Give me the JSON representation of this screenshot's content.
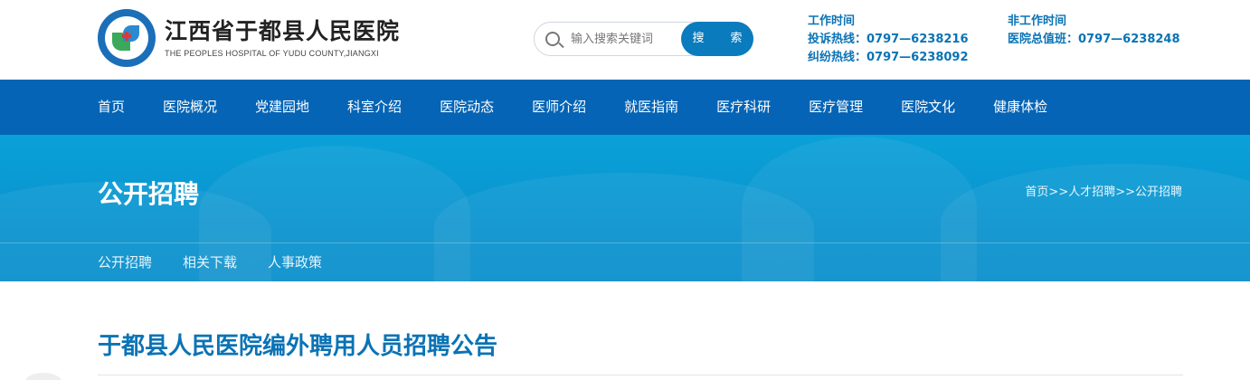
{
  "header": {
    "logo_cn": "江西省于都县人民医院",
    "logo_en": "THE PEOPLES HOSPITAL OF YUDU COUNTY,JIANGXI",
    "search_placeholder": "输入搜索关键词",
    "search_button": "搜　索",
    "contact_left": {
      "label": "工作时间",
      "line1": "投诉热线：0797—6238216",
      "line2": "纠纷热线：0797—6238092"
    },
    "contact_right": {
      "label": "非工作时间",
      "line1": "医院总值班：0797—6238248"
    }
  },
  "nav": {
    "items": [
      "首页",
      "医院概况",
      "党建园地",
      "科室介绍",
      "医院动态",
      "医师介绍",
      "就医指南",
      "医疗科研",
      "医疗管理",
      "医院文化",
      "健康体检"
    ]
  },
  "banner": {
    "title": "公开招聘",
    "breadcrumb": "首页>>人才招聘>>公开招聘"
  },
  "subnav": {
    "items": [
      "公开招聘",
      "相关下载",
      "人事政策"
    ]
  },
  "article": {
    "title": "于都县人民医院编外聘用人员招聘公告"
  },
  "colors": {
    "brand_blue": "#0564b5",
    "accent_blue": "#0a73b5",
    "banner_blue": "#0a9ad4"
  },
  "icons": [
    "hospital-logo-icon",
    "search-icon"
  ]
}
